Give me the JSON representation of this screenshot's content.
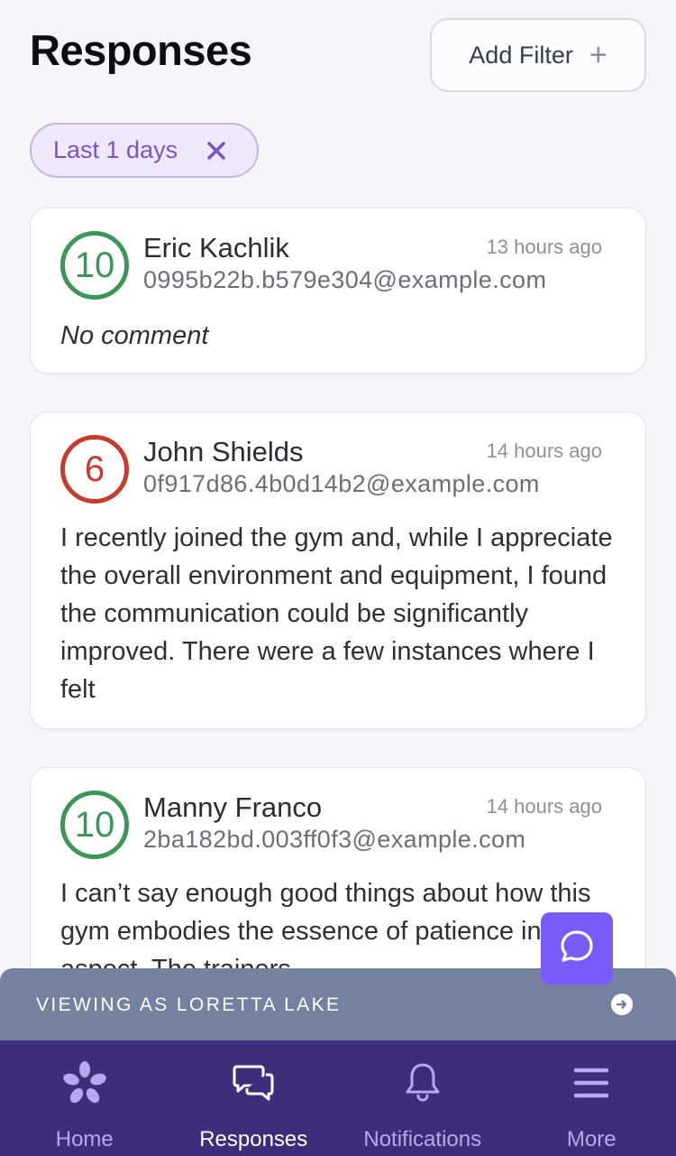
{
  "header": {
    "title": "Responses",
    "add_filter_label": "Add Filter",
    "add_filter_icon": "plus-icon"
  },
  "filters": [
    {
      "label": "Last 1 days",
      "remove_icon": "close-icon"
    }
  ],
  "responses": [
    {
      "score": "10",
      "sentiment": "good",
      "name": "Eric Kachlik",
      "email": "0995b22b.b579e304@example.com",
      "time": "13 hours ago",
      "comment": "No comment"
    },
    {
      "score": "6",
      "sentiment": "bad",
      "name": "John Shields",
      "email": "0f917d86.4b0d14b2@example.com",
      "time": "14 hours ago",
      "comment": "I recently joined the gym and, while I appreciate the overall environment and equipment, I found the communication could be significantly improved. There were a few instances where I felt"
    },
    {
      "score": "10",
      "sentiment": "good",
      "name": "Manny Franco",
      "email": "2ba182bd.003ff0f3@example.com",
      "time": "14 hours ago",
      "comment": "I can’t say enough good things about how this gym embodies the essence of patience in every aspect. The trainers"
    }
  ],
  "chat": {
    "icon": "chat-bubble-icon"
  },
  "viewing_banner": {
    "text": "VIEWING AS LORETTA LAKE",
    "icon": "arrow-right-circle-icon"
  },
  "bottom_nav": {
    "items": [
      {
        "label": "Home",
        "icon": "star-logo-icon",
        "active": false
      },
      {
        "label": "Responses",
        "icon": "chat-bubbles-icon",
        "active": true
      },
      {
        "label": "Notifications",
        "icon": "bell-icon",
        "active": false
      },
      {
        "label": "More",
        "icon": "menu-icon",
        "active": false
      }
    ]
  },
  "colors": {
    "accent": "#7a5af8",
    "nav_bg": "#3e2d7a",
    "banner_bg": "#7581a1",
    "score_good": "#3d9557",
    "score_bad": "#c63b2c",
    "chip_bg": "#efe8fa"
  }
}
